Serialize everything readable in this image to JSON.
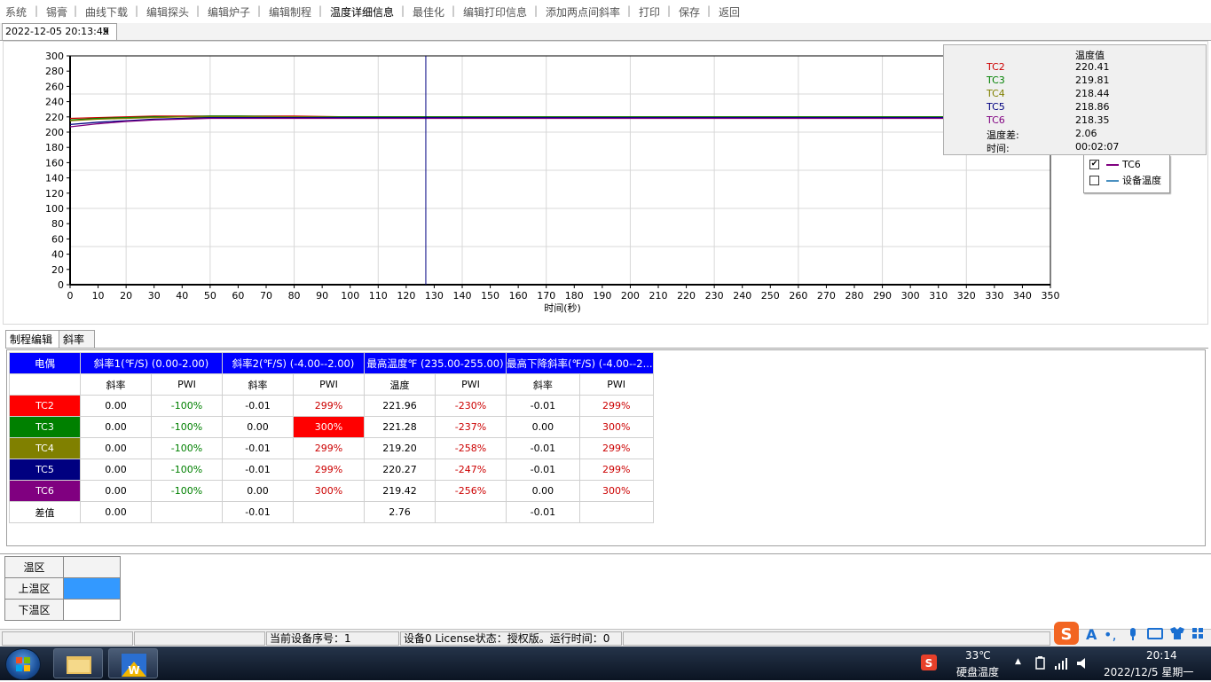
{
  "menu": [
    "系统",
    "锡膏",
    "曲线下载",
    "编辑探头",
    "编辑炉子",
    "编辑制程",
    "温度详细信息",
    "最佳化",
    "编辑打印信息",
    "添加两点间斜率",
    "打印",
    "保存",
    "返回"
  ],
  "menu_active_index": 6,
  "doc_tab": {
    "title": "2022-12-05 20:13:49",
    "close": "X"
  },
  "chart_data": {
    "type": "line",
    "xlabel": "时间(秒)",
    "ylabel": "",
    "xlim": [
      0,
      350
    ],
    "ylim": [
      0,
      300
    ],
    "x_ticks": [
      0,
      10,
      20,
      30,
      40,
      50,
      60,
      70,
      80,
      90,
      100,
      110,
      120,
      130,
      140,
      150,
      160,
      170,
      180,
      190,
      200,
      210,
      220,
      230,
      240,
      250,
      260,
      270,
      280,
      290,
      300,
      310,
      320,
      330,
      340,
      350
    ],
    "y_ticks": [
      0,
      20,
      40,
      60,
      80,
      100,
      120,
      140,
      160,
      180,
      200,
      220,
      240,
      260,
      280,
      300
    ],
    "grid": true,
    "cursor_x": 127,
    "series": [
      {
        "name": "TC2",
        "color": "#cc0000",
        "x": [
          0,
          10,
          20,
          30,
          40,
          50,
          60,
          80,
          100,
          127,
          200,
          300,
          350
        ],
        "y": [
          218,
          219,
          220,
          221,
          221,
          221,
          221,
          221,
          220,
          220,
          220,
          220,
          220
        ]
      },
      {
        "name": "TC3",
        "color": "#008000",
        "x": [
          0,
          10,
          20,
          30,
          40,
          50,
          60,
          80,
          100,
          127,
          200,
          300,
          350
        ],
        "y": [
          216,
          218,
          219,
          220,
          220,
          221,
          221,
          220,
          220,
          220,
          220,
          220,
          220
        ]
      },
      {
        "name": "TC4",
        "color": "#808000",
        "x": [
          0,
          10,
          20,
          30,
          40,
          50,
          60,
          80,
          100,
          127,
          200,
          300,
          350
        ],
        "y": [
          215,
          217,
          218,
          219,
          220,
          220,
          220,
          220,
          219,
          219,
          219,
          219,
          219
        ]
      },
      {
        "name": "TC5",
        "color": "#000080",
        "x": [
          0,
          10,
          20,
          30,
          40,
          50,
          60,
          80,
          100,
          127,
          200,
          300,
          350
        ],
        "y": [
          210,
          213,
          215,
          217,
          218,
          219,
          219,
          219,
          219,
          219,
          219,
          219,
          219
        ]
      },
      {
        "name": "TC6",
        "color": "#800080",
        "x": [
          0,
          10,
          20,
          30,
          40,
          50,
          60,
          80,
          100,
          127,
          200,
          300,
          350
        ],
        "y": [
          207,
          211,
          214,
          216,
          217,
          218,
          218,
          218,
          218,
          218,
          218,
          218,
          218
        ]
      }
    ]
  },
  "info_box": {
    "header": "温度值",
    "rows": [
      {
        "name": "TC2",
        "value": "220.41",
        "color": "#cc0000"
      },
      {
        "name": "TC3",
        "value": "219.81",
        "color": "#008000"
      },
      {
        "name": "TC4",
        "value": "218.44",
        "color": "#808000"
      },
      {
        "name": "TC5",
        "value": "218.86",
        "color": "#000080"
      },
      {
        "name": "TC6",
        "value": "218.35",
        "color": "#800080"
      },
      {
        "name": "温度差:",
        "value": "2.06",
        "color": "#000000"
      },
      {
        "name": "时间:",
        "value": "00:02:07",
        "color": "#000000"
      }
    ]
  },
  "legend": [
    {
      "label": "TC6",
      "checked": true,
      "color": "#800080"
    },
    {
      "label": "设备温度",
      "checked": false,
      "color": "#4a90c0"
    }
  ],
  "lower_tabs": [
    "制程编辑",
    "斜率"
  ],
  "process_table": {
    "group_headers": [
      "电偶",
      "斜率1(℉/S) (0.00-2.00)",
      "斜率2(℉/S) (-4.00--2.00)",
      "最高温度℉ (235.00-255.00)",
      "最高下降斜率(℉/S) (-4.00--2..."
    ],
    "sub_headers": [
      "",
      "斜率",
      "PWI",
      "斜率",
      "PWI",
      "温度",
      "PWI",
      "斜率",
      "PWI"
    ],
    "rows": [
      {
        "name": "TC2",
        "color": "#ff0000",
        "cells": [
          "0.00",
          "-100%",
          "-0.01",
          "299%",
          "221.96",
          "-230%",
          "-0.01",
          "299%"
        ]
      },
      {
        "name": "TC3",
        "color": "#008000",
        "cells": [
          "0.00",
          "-100%",
          "0.00",
          "300%",
          "221.28",
          "-237%",
          "0.00",
          "300%"
        ]
      },
      {
        "name": "TC4",
        "color": "#808000",
        "cells": [
          "0.00",
          "-100%",
          "-0.01",
          "299%",
          "219.20",
          "-258%",
          "-0.01",
          "299%"
        ]
      },
      {
        "name": "TC5",
        "color": "#000080",
        "cells": [
          "0.00",
          "-100%",
          "-0.01",
          "299%",
          "220.27",
          "-247%",
          "-0.01",
          "299%"
        ]
      },
      {
        "name": "TC6",
        "color": "#800080",
        "cells": [
          "0.00",
          "-100%",
          "0.00",
          "300%",
          "219.42",
          "-256%",
          "0.00",
          "300%"
        ]
      }
    ],
    "diff_row": {
      "name": "差值",
      "cells": [
        "0.00",
        "",
        "-0.01",
        "",
        "2.76",
        "",
        "-0.01",
        ""
      ]
    }
  },
  "zone_table": {
    "header": "温区",
    "rows": [
      "上温区",
      "下温区"
    ],
    "upper_color": "#3399ff"
  },
  "status_bar": {
    "device_no": "当前设备序号：1",
    "device_info": "设备0   License状态：授权版。运行时间：0"
  },
  "taskbar": {
    "weather_temp": "33℃",
    "weather_label": "硬盘温度",
    "time": "20:14",
    "date": "2022/12/5 星期一"
  }
}
